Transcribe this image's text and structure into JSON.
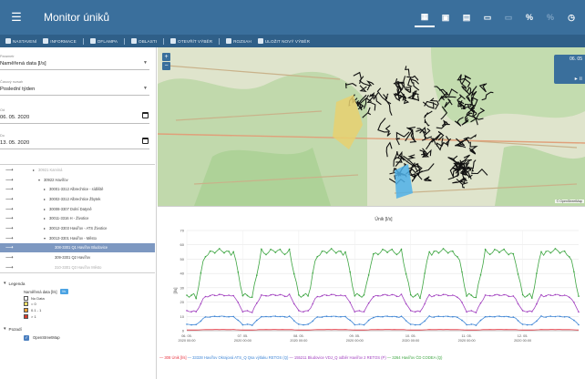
{
  "header": {
    "title": "Monitor úniků",
    "icons": [
      {
        "name": "map-table-icon",
        "glyph": "▦",
        "active": true
      },
      {
        "name": "map-graph-icon",
        "glyph": "▣",
        "active": false
      },
      {
        "name": "calendar-icon",
        "glyph": "▤",
        "active": false
      },
      {
        "name": "monitor-icon",
        "glyph": "▭",
        "active": false
      },
      {
        "name": "monitor-disabled-icon",
        "glyph": "▭",
        "active": false,
        "dim": true
      },
      {
        "name": "percent-icon",
        "glyph": "%",
        "active": false
      },
      {
        "name": "percent-disabled-icon",
        "glyph": "%",
        "active": false,
        "dim": true
      },
      {
        "name": "clock-icon",
        "glyph": "◷",
        "active": false
      }
    ]
  },
  "toolbar": {
    "items": [
      {
        "name": "settings-button",
        "label": "NASTAVENÍ"
      },
      {
        "name": "info-button",
        "label": "INFORMACE"
      },
      {
        "name": "sep1"
      },
      {
        "name": "export-button",
        "label": "OFLAMPA"
      },
      {
        "name": "sep2"
      },
      {
        "name": "selections-button",
        "label": "OBLASTI"
      },
      {
        "name": "sep3"
      },
      {
        "name": "open-view-button",
        "label": "OTEVŘÍT VÝBĚR"
      },
      {
        "name": "sep4"
      },
      {
        "name": "loc-button",
        "label": "ROZSAH"
      },
      {
        "name": "save-view-button",
        "label": "ULOŽIT NOVÝ VÝBĚR"
      }
    ]
  },
  "filters": {
    "parameter": {
      "label": "Parametr",
      "value": "Naměřená data [l/s]"
    },
    "time_range": {
      "label": "Časový rozsah",
      "value": "Poslední týden"
    },
    "from": {
      "label": "Od",
      "value": "06. 05. 2020"
    },
    "to": {
      "label": "Do",
      "value": "13. 05. 2020"
    }
  },
  "tree": [
    {
      "label": "30921 Karviná",
      "indent": 0,
      "cut": true
    },
    {
      "label": "30922 Havířov",
      "indent": 1,
      "open": true
    },
    {
      "label": "30001-3312 Albrechtice - sídliště",
      "indent": 2
    },
    {
      "label": "30002-3312 Albrechtice Žbytek",
      "indent": 2
    },
    {
      "label": "30008-3307 Dolní Datyně",
      "indent": 2
    },
    {
      "label": "30011-3316 H - Životice",
      "indent": 2
    },
    {
      "label": "30012-3303 Havířov - ATS Životice",
      "indent": 2
    },
    {
      "label": "30013-3301 Havířov - Město",
      "indent": 2,
      "open": true
    },
    {
      "label": "308-3301 Q1 Havířov Bludovice",
      "indent": 3,
      "selected": true
    },
    {
      "label": "309-3301 Q2 Havířov",
      "indent": 3
    },
    {
      "label": "310-3301 Q3 Havířov Město",
      "indent": 3,
      "cut": true
    }
  ],
  "legend": {
    "title": "Legenda",
    "measured_label": "Naměřená data [l/s]",
    "badge": "l/s",
    "items": [
      {
        "label": "No Data",
        "color": "#ffffff"
      },
      {
        "label": "= 0",
        "color": "#f2e06a"
      },
      {
        "label": "0.1 - 1",
        "color": "#f0a030"
      },
      {
        "label": "> 1",
        "color": "#d83a2a"
      }
    ]
  },
  "background": {
    "title": "Pozadí",
    "item": "OpenStreetMap"
  },
  "map": {
    "zoom_in": "+",
    "zoom_out": "−",
    "ctrl_top": "06. 05",
    "ctrl_play": "▸ ॥",
    "attribution": "© OpenStreetMap"
  },
  "chart_data": {
    "type": "line",
    "title": "Únik [l/s]",
    "ylabel": "[l/s]",
    "xlabel": "",
    "ylim": [
      0,
      70
    ],
    "yticks": [
      0,
      10,
      20,
      30,
      40,
      50,
      60,
      70
    ],
    "xtick_labels": [
      [
        "06. 05.",
        "2020 00:00"
      ],
      [
        "07. 05.",
        "2020 00:00"
      ],
      [
        "08. 05.",
        "2020 00:00"
      ],
      [
        "09. 05.",
        "2020 00:00"
      ],
      [
        "10. 05.",
        "2020 00:00"
      ],
      [
        "11. 05.",
        "2020 00:00"
      ],
      [
        "12. 05.",
        "2020 00:00"
      ]
    ],
    "days": 7,
    "series": [
      {
        "name": "308 Únik [l/s]",
        "color": "#e8323f",
        "base": 0.5,
        "amp": 0.3
      },
      {
        "name": "33328 Havířov Okrajová ATS_Q Qsa výtlaku RETOS (Q)",
        "color": "#3f86d6",
        "base": 4,
        "amp": 6
      },
      {
        "name": "155211 Bludovice VDJ_Q odběr Havířov 2 RETOS (P)",
        "color": "#a13fbf",
        "base": 13,
        "amp": 12
      },
      {
        "name": "3264 Havířov ČD CODEA (Q)",
        "color": "#3ca540",
        "base": 23,
        "amp": 33
      }
    ],
    "legend_text": "— 308 Únik [l/s] — 33328 Havířov Okrajová ATS_Q Qsa výtlaku RETOS (Q) — 155211 Bludovice VDJ_Q odběr Havířov 2 RETOS (P) — 3264 Havířov ČD CODEA (Q)"
  }
}
